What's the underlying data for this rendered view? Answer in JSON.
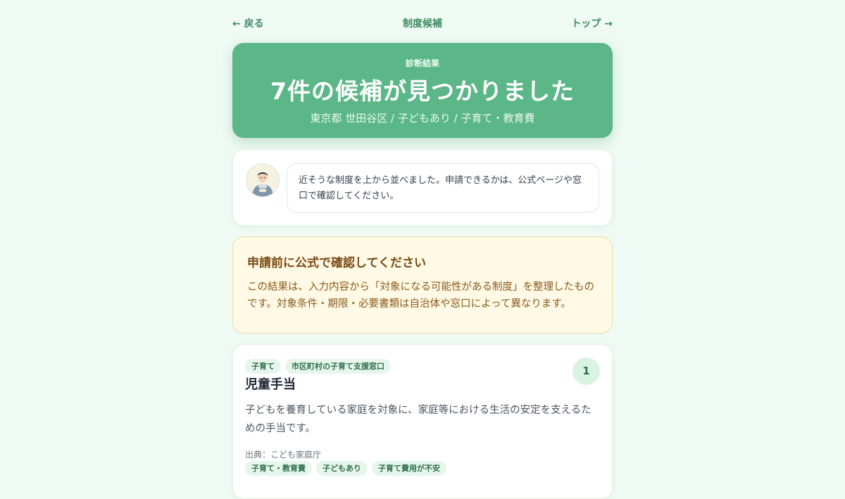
{
  "nav": {
    "back_label": "← 戻る",
    "title": "制度候補",
    "top_label": "トップ →"
  },
  "hero": {
    "eyebrow": "診断結果",
    "title": "7件の候補が見つかりました",
    "subtitle": "東京都 世田谷区 / 子どもあり / 子育て・教育費"
  },
  "assistant": {
    "avatar_icon": "person-avatar-icon",
    "message": "近そうな制度を上から並べました。申請できるかは、公式ページや窓口で確認してください。"
  },
  "notice": {
    "title": "申請前に公式で確認してください",
    "body": "この結果は、入力内容から「対象になる可能性がある制度」を整理したものです。対象条件・期限・必要書類は自治体や窓口によって異なります。"
  },
  "results": [
    {
      "rank": "1",
      "tags": [
        "子育て",
        "市区町村の子育て支援窓口"
      ],
      "title": "児童手当",
      "description": "子どもを養育している家庭を対象に、家庭等における生活の安定を支えるための手当です。",
      "source": "出典：こども家庭庁",
      "match_tags": [
        "子育て・教育費",
        "子どもあり",
        "子育て費用が不安"
      ]
    }
  ],
  "colors": {
    "background": "#eefaf3",
    "accent": "#5bb787",
    "nav_text": "#3f8b62",
    "notice_bg": "#fff9e6",
    "notice_text": "#7a4a12"
  }
}
